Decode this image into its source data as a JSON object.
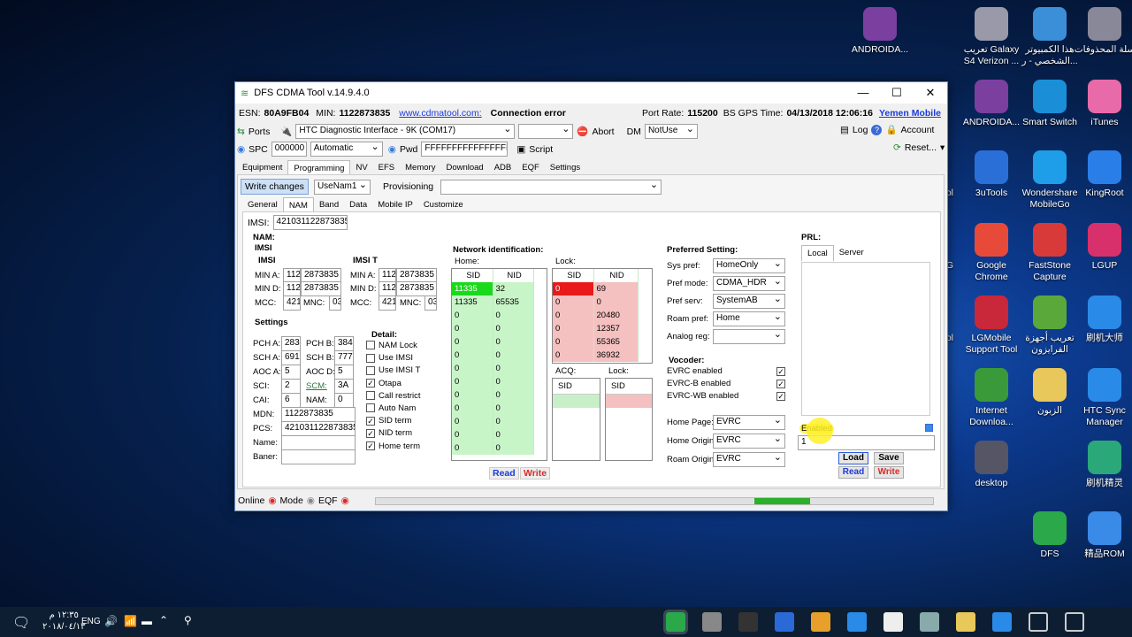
{
  "desktop": {
    "icons": [
      {
        "label": "ANDROIDA...",
        "color": "#7b3fa0"
      },
      {
        "label": "تعريب Galaxy S4 Verizon ...",
        "color": "#99a"
      },
      {
        "label": "هذا الكمبيوتر الشخصي - ر...",
        "color": "#3b8fd8"
      },
      {
        "label": "سلة المحذوفات",
        "color": "#889"
      },
      {
        "label": "ANDROIDA...",
        "color": "#7b3fa0"
      },
      {
        "label": "Smart Switch",
        "color": "#1a8fd8"
      },
      {
        "label": "iTunes",
        "color": "#e86aa8"
      },
      {
        "label": "3uTools",
        "color": "#2a6fd8"
      },
      {
        "label": "Wondershare MobileGo",
        "color": "#1e9ee8"
      },
      {
        "label": "KingRoot",
        "color": "#2a7ee8"
      },
      {
        "label": "Google Chrome",
        "color": "#e84a3a"
      },
      {
        "label": "FastStone Capture",
        "color": "#d83a3a"
      },
      {
        "label": "LGUP",
        "color": "#d8306a"
      },
      {
        "label": "LGMobile Support Tool",
        "color": "#c8283a"
      },
      {
        "label": "تعريب أجهزة الفرايزون",
        "color": "#5aa83a"
      },
      {
        "label": "刷机大师",
        "color": "#2a8ae8"
      },
      {
        "label": "Internet Downloa...",
        "color": "#3a9a3a"
      },
      {
        "label": "الزبون",
        "color": "#e8c85a"
      },
      {
        "label": "HTC Sync Manager",
        "color": "#2a8ae8"
      },
      {
        "label": "desktop",
        "color": "#556"
      },
      {
        "label": "刷机精灵",
        "color": "#2aa87a"
      },
      {
        "label": "DFS",
        "color": "#2aa84a"
      },
      {
        "label": "精品ROM",
        "color": "#3a8ae8"
      },
      {
        "label": "ool",
        "color": "#444"
      },
      {
        "label": "LG",
        "color": "#444"
      },
      {
        "label": "ool",
        "color": "#444"
      }
    ]
  },
  "window": {
    "title": "DFS CDMA Tool v.14.9.4.0"
  },
  "info": {
    "esn_label": "ESN:",
    "esn": "80A9FB04",
    "min_label": "MIN:",
    "min": "1122873835",
    "link": "www.cdmatool.com:",
    "status": "Connection error",
    "port_label": "Port Rate:",
    "port": "115200",
    "gps_label": "BS GPS Time:",
    "gps": "04/13/2018 12:06:16",
    "carrier": "Yemen Mobile"
  },
  "toolbar1": {
    "ports": "Ports",
    "interface": "HTC Diagnostic Interface - 9K (COM17)",
    "abort": "Abort",
    "dm_label": "DM",
    "dm": "NotUse",
    "log": "Log",
    "account": "Account"
  },
  "toolbar2": {
    "spc_label": "SPC",
    "spc": "000000",
    "mode": "Automatic",
    "pwd_label": "Pwd",
    "pwd": "FFFFFFFFFFFFFFFF",
    "script": "Script",
    "reset": "Reset..."
  },
  "menu": [
    "Equipment",
    "Programming",
    "NV",
    "EFS",
    "Memory",
    "Download",
    "ADB",
    "EQF",
    "Settings"
  ],
  "prog": {
    "write_changes": "Write changes",
    "nam": "UseNam1",
    "provisioning": "Provisioning"
  },
  "subtabs": [
    "General",
    "NAM",
    "Band",
    "Data",
    "Mobile IP",
    "Customize"
  ],
  "imsi": {
    "label": "IMSI:",
    "value": "421031122873835"
  },
  "nam": {
    "title": "NAM:",
    "imsi": "IMSI",
    "imsi_block": "IMSI",
    "imsi_t": "IMSI T",
    "mina": "MIN A:",
    "mind": "MIN D:",
    "mcc": "MCC:",
    "mnc": "MNC:",
    "min_a1": "112",
    "min_a2": "2873835",
    "min_d1": "112",
    "min_d2": "2873835",
    "mcc_v": "421",
    "mnc_v": "03",
    "t_min_a1": "112",
    "t_min_a2": "2873835",
    "t_min_d1": "112",
    "t_min_d2": "2873835",
    "t_mcc_v": "421",
    "t_mnc_v": "03"
  },
  "settings": {
    "title": "Settings",
    "pcha": "PCH A:",
    "pcha_v": "283",
    "pchb": "PCH B:",
    "pchb_v": "384",
    "scha": "SCH A:",
    "scha_v": "691",
    "schb": "SCH B:",
    "schb_v": "777",
    "aoca": "AOC A:",
    "aoca_v": "5",
    "aocd": "AOC D:",
    "aocd_v": "5",
    "sci": "SCI:",
    "sci_v": "2",
    "scm": "SCM:",
    "scm_v": "3A",
    "cai": "CAI:",
    "cai_v": "6",
    "namf": "NAM:",
    "namf_v": "0",
    "mdn": "MDN:",
    "mdn_v": "1122873835",
    "pcs": "PCS:",
    "pcs_v": "421031122873835",
    "name": "Name:",
    "baner": "Baner:"
  },
  "detail": {
    "title": "Detail:",
    "items": [
      {
        "l": "NAM Lock",
        "c": false
      },
      {
        "l": "Use IMSI",
        "c": false
      },
      {
        "l": "Use IMSI T",
        "c": false
      },
      {
        "l": "Otapa",
        "c": true
      },
      {
        "l": "Call restrict",
        "c": false
      },
      {
        "l": "Auto Nam",
        "c": false
      },
      {
        "l": "SID term",
        "c": true
      },
      {
        "l": "NID term",
        "c": true
      },
      {
        "l": "Home term",
        "c": true
      }
    ]
  },
  "network": {
    "title": "Network identification:",
    "home": "Home:",
    "lock": "Lock:",
    "sid": "SID",
    "nid": "NID",
    "acq": "ACQ:",
    "lock2": "Lock:",
    "home_rows": [
      [
        "11335",
        "32"
      ],
      [
        "11335",
        "65535"
      ],
      [
        "0",
        "0"
      ],
      [
        "0",
        "0"
      ],
      [
        "0",
        "0"
      ],
      [
        "0",
        "0"
      ],
      [
        "0",
        "0"
      ],
      [
        "0",
        "0"
      ],
      [
        "0",
        "0"
      ],
      [
        "0",
        "0"
      ],
      [
        "0",
        "0"
      ],
      [
        "0",
        "0"
      ],
      [
        "0",
        "0"
      ]
    ],
    "lock_rows": [
      [
        "0",
        "69"
      ],
      [
        "0",
        "0"
      ],
      [
        "0",
        "20480"
      ],
      [
        "0",
        "12357"
      ],
      [
        "0",
        "55365"
      ],
      [
        "0",
        "36932"
      ]
    ],
    "read": "Read",
    "write": "Write"
  },
  "pref": {
    "title": "Preferred Setting:",
    "rows": [
      {
        "l": "Sys pref:",
        "v": "HomeOnly"
      },
      {
        "l": "Pref mode:",
        "v": "CDMA_HDR"
      },
      {
        "l": "Pref serv:",
        "v": "SystemAB"
      },
      {
        "l": "Roam pref:",
        "v": "Home"
      },
      {
        "l": "Analog reg:",
        "v": ""
      }
    ]
  },
  "vocoder": {
    "title": "Vocoder:",
    "items": [
      "EVRC enabled",
      "EVRC-B enabled",
      "EVRC-WB enabled"
    ],
    "rows": [
      {
        "l": "Home Page:",
        "v": "EVRC"
      },
      {
        "l": "Home Origin:",
        "v": "EVRC"
      },
      {
        "l": "Roam Origin:",
        "v": "EVRC"
      }
    ]
  },
  "prl": {
    "title": "PRL:",
    "local": "Local",
    "server": "Server",
    "enabled": "Enabled",
    "value": "1",
    "load": "Load",
    "save": "Save",
    "read": "Read",
    "write": "Write"
  },
  "status": {
    "online": "Online",
    "mode": "Mode",
    "eqf": "EQF",
    "progress": 0.3
  },
  "taskbar": {
    "time": "١٢:٣٥ م",
    "date": "٢٠١٨/٠٤/١٣",
    "lang": "ENG"
  }
}
